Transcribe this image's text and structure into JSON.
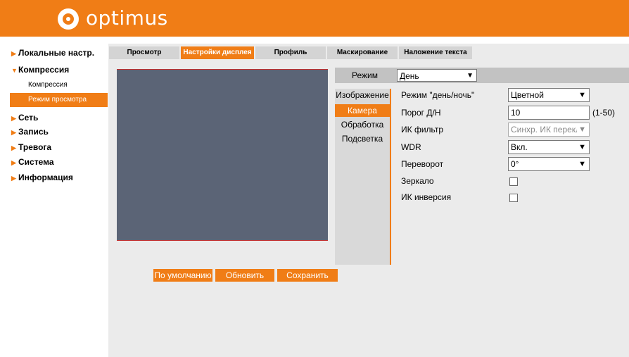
{
  "brand": {
    "name": "optimus",
    "color": "#f07d16"
  },
  "sidebar": {
    "items": [
      {
        "label": "Локальные настр."
      },
      {
        "label": "Компрессия"
      },
      {
        "label": "Сеть"
      },
      {
        "label": "Запись"
      },
      {
        "label": "Тревога"
      },
      {
        "label": "Система"
      },
      {
        "label": "Информация"
      }
    ],
    "subitems": [
      {
        "label": "Компрессия"
      },
      {
        "label": "Режим просмотра",
        "active": true
      }
    ]
  },
  "tabs": [
    {
      "label": "Просмотр"
    },
    {
      "label": "Настройки дисплея",
      "active": true
    },
    {
      "label": "Профиль"
    },
    {
      "label": "Маскирование"
    },
    {
      "label": "Наложение текста"
    }
  ],
  "mode": {
    "label": "Режим",
    "value": "День"
  },
  "subpanel": {
    "items": [
      {
        "label": "Изображение"
      },
      {
        "label": "Камера",
        "active": true
      },
      {
        "label": "Обработка"
      },
      {
        "label": "Подсветка"
      }
    ]
  },
  "settings": {
    "day_night": {
      "label": "Режим \"день/ночь\"",
      "value": "Цветной"
    },
    "threshold": {
      "label": "Порог Д/Н",
      "value": "10",
      "range": "(1-50)"
    },
    "ir_filter": {
      "label": "ИК фильтр",
      "value": "Синхр. ИК перекл"
    },
    "wdr": {
      "label": "WDR",
      "value": "Вкл."
    },
    "flip": {
      "label": "Переворот",
      "value": "0°"
    },
    "mirror": {
      "label": "Зеркало",
      "checked": false
    },
    "ir_inversion": {
      "label": "ИК инверсия",
      "checked": false
    }
  },
  "buttons": {
    "default": "По умолчанию",
    "refresh": "Обновить",
    "save": "Сохранить"
  }
}
